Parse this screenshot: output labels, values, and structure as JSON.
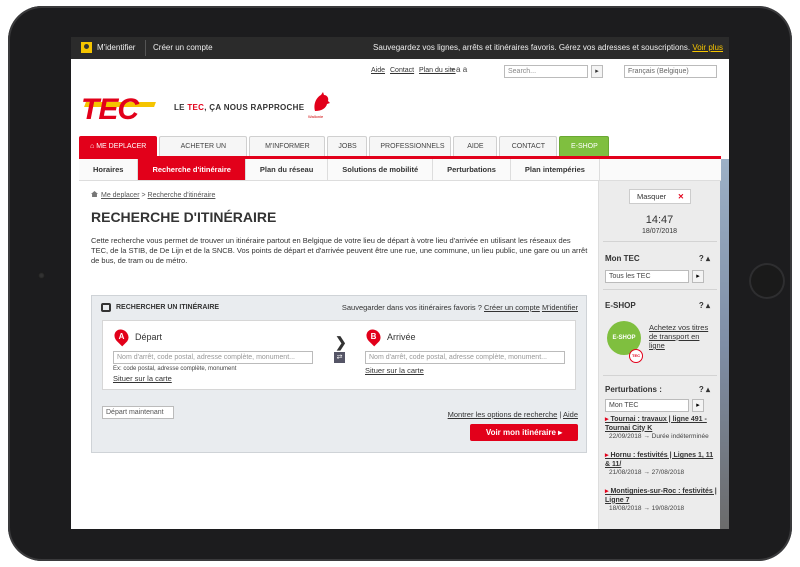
{
  "topbar": {
    "login": "M'identifier",
    "create_account": "Créer un compte",
    "promo": "Sauvegardez vos lignes, arrêts et itinéraires favoris. Gérez vos adresses et souscriptions.",
    "promo_link": "Voir plus"
  },
  "utility": {
    "aide": "Aide",
    "contact": "Contact",
    "plan": "Plan du site",
    "font_sizes": "▪ a a",
    "search_placeholder": "Search...",
    "search_btn": "▸",
    "language": "Français (Belgique)"
  },
  "brand": {
    "logo": "TEC",
    "tagline_pre": "LE",
    "tagline_brand": "TEC",
    "tagline_post": ", ÇA NOUS RAPPROCHE",
    "wallonie": "Wallonie"
  },
  "tabs": [
    "ME DEPLACER",
    "ACHETER UN TITRE",
    "M'INFORMER",
    "JOBS",
    "PROFESSIONNELS",
    "AIDE",
    "CONTACT",
    "E-SHOP"
  ],
  "subnav": [
    "Horaires",
    "Recherche d'itinéraire",
    "Plan du réseau",
    "Solutions de mobilité",
    "Perturbations",
    "Plan intempéries"
  ],
  "breadcrumb": {
    "home": "Me deplacer",
    "sep": ">",
    "current": "Recherche d'itinéraire"
  },
  "page_title": "RECHERCHE D'ITINÉRAIRE",
  "intro": "Cette recherche vous permet de trouver un itinéraire partout en Belgique de votre lieu de départ à votre lieu d'arrivée en utilisant les réseaux des TEC, de la STIB, de De Lijn et de la SNCB. Vos points de départ et d'arrivée peuvent être une rue, une commune, un lieu public, une gare ou un arrêt de bus, de tram ou de métro.",
  "panel": {
    "title": "RECHERCHER UN ITINÉRAIRE",
    "save_text": "Sauvegarder dans vos itinéraires favoris ?",
    "save_create": "Créer un compte",
    "save_login": "M'identifier",
    "from_letter": "A",
    "from_label": "Départ",
    "from_placeholder": "Nom d'arrêt, code postal, adresse complète, monument...",
    "from_hint": "Ex: code postal, adresse complète, monument",
    "from_map": "Situer sur la carte",
    "to_letter": "B",
    "to_label": "Arrivée",
    "to_placeholder": "Nom d'arrêt, code postal, adresse complète, monument...",
    "to_map": "Situer sur la carte",
    "swap": "⇄",
    "arrow": "❯",
    "depart_now": "Départ maintenant",
    "options_link": "Montrer les options de recherche",
    "options_sep": "|",
    "options_help": "Aide",
    "submit": "Voir mon itinéraire ▸"
  },
  "sidebar": {
    "hide": "Masquer",
    "hide_x": "✕",
    "time": "14:47",
    "date": "18/07/2018",
    "montec_title": "Mon TEC",
    "montec_select": "Tous les TEC",
    "eshop_title": "E-SHOP",
    "eshop_icon": "E-SHOP",
    "eshop_badge": "TEC",
    "eshop_text": "Achetez vos titres de transport en ligne",
    "pert_title": "Perturbations :",
    "pert_select": "Mon TEC",
    "help_q": "?",
    "collapse": "▴",
    "disruptions": [
      {
        "title": "Tournai : travaux | ligne 491 - Tournai City K",
        "dates": "22/09/2018 → Durée indéterminée"
      },
      {
        "title": "Hornu : festivités | Lignes 1, 11 & 11/",
        "dates": "21/08/2018 → 27/08/2018"
      },
      {
        "title": "Montignies-sur-Roc : festivités | Ligne 7",
        "dates": "18/08/2018 → 19/08/2018"
      }
    ]
  }
}
